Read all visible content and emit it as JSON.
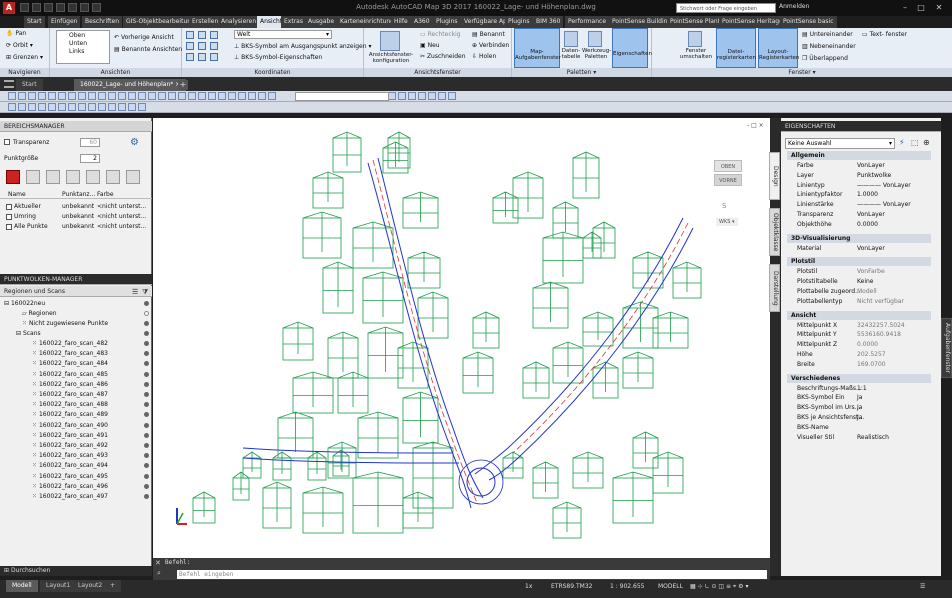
{
  "title_bar": {
    "title": "Autodesk AutoCAD Map 3D 2017   160022_Lage- und Höhenplan.dwg",
    "search_placeholder": "Stichwort oder Frage eingeben",
    "user": "Anmelden"
  },
  "ribbon_tabs": [
    "Start",
    "Einfügen",
    "Beschriften",
    "GIS-Objektbearbeitung",
    "Erstellen",
    "Analysieren",
    "Ansicht",
    "Extras",
    "Ausgabe",
    "Karteneinrichtung",
    "Hilfe",
    "A360",
    "Plugins",
    "Verfügbare Apps",
    "Plugins",
    "BIM 360",
    "Performance",
    "PointSense Building",
    "PointSense Plant",
    "PointSense Heritage",
    "PointSense basic"
  ],
  "ribbon_active": "Ansicht",
  "ribbon": {
    "navigieren": {
      "title": "Navigieren",
      "items": [
        "Pan",
        "Orbit",
        "Grenzen"
      ]
    },
    "ansichten": {
      "title": "Ansichten",
      "items": [
        "Oben",
        "Unten",
        "Links"
      ],
      "prev": "Vorherige Ansicht",
      "named": "Benannte Ansichten"
    },
    "koordinaten": {
      "title": "Koordinaten",
      "welt": "Welt",
      "ucs_show": "BKS-Symbol am Ausgangspunkt anzeigen",
      "ucs_props": "BKS-Symbol-Eigenschaften"
    },
    "ansichtsfenster": {
      "title": "Ansichtsfenster",
      "config": "Ansichtsfenster-konfiguration",
      "items": [
        "Rechteckig",
        "Neu",
        "Zuschneiden",
        "Benannt",
        "Verbinden",
        "Holen"
      ]
    },
    "paletten": {
      "title": "Paletten",
      "items": [
        "Map-Aufgabenfenster",
        "Daten-tabelle",
        "Werkzeug-Paletten",
        "Eigenschaften"
      ]
    },
    "fenster": {
      "title": "Fenster",
      "items": [
        "Fenster umschalten",
        "Datei-registerkarten",
        "Layout-Registerkarten"
      ],
      "arrange": [
        "Untereinander",
        "Nebeneinander",
        "Überlappend"
      ],
      "textfenster": "Text- fenster"
    }
  },
  "file_tabs": [
    "Start",
    "160022_Lage- und Höhenplan*"
  ],
  "bereichsmanager": {
    "title": "BEREICHSMANAGER",
    "transparenz": "Transparenz",
    "transparenz_val": "60",
    "punktgroesse": "Punktgröße",
    "punktgroesse_val": "2",
    "cols": [
      "Name",
      "Punktanz...",
      "Farbe"
    ],
    "rows": [
      [
        "Aktueller",
        "unbekannt",
        "<nicht unterst..."
      ],
      [
        "Umring",
        "unbekannt",
        "<nicht unterst..."
      ],
      [
        "Alle Punkte",
        "unbekannt",
        "<nicht unterst..."
      ]
    ]
  },
  "punktwolken": {
    "title": "PUNKTWOLKEN-MANAGER",
    "sub": "Regionen und Scans",
    "root": "160022neu",
    "regionen": "Regionen",
    "nicht": "Nicht zugewiesene Punkte",
    "scans_label": "Scans",
    "scans": [
      "160022_faro_scan_482",
      "160022_faro_scan_483",
      "160022_faro_scan_484",
      "160022_faro_scan_485",
      "160022_faro_scan_486",
      "160022_faro_scan_487",
      "160022_faro_scan_488",
      "160022_faro_scan_489",
      "160022_faro_scan_490",
      "160022_faro_scan_491",
      "160022_faro_scan_492",
      "160022_faro_scan_493",
      "160022_faro_scan_494",
      "160022_faro_scan_495",
      "160022_faro_scan_496",
      "160022_faro_scan_497"
    ],
    "footer": "Durchsuchen"
  },
  "viewcube": {
    "top": "OBEN",
    "front": "VORNE",
    "south": "S",
    "wcs": "WKS"
  },
  "command": {
    "label": "Befehl:",
    "placeholder": "Befehl eingeben"
  },
  "eigenschaften": {
    "title": "EIGENSCHAFTEN",
    "selection": "Keine Auswahl",
    "vtabs": [
      "Design",
      "Objektklasse",
      "Darstellung"
    ],
    "side_label": "Aufgabenfenster",
    "sections": [
      {
        "name": "Allgemein",
        "props": [
          [
            "Farbe",
            "VonLayer"
          ],
          [
            "Layer",
            "Punktwolke"
          ],
          [
            "Linientyp",
            "———— VonLayer"
          ],
          [
            "Linientypfaktor",
            "1.0000"
          ],
          [
            "Linienstärke",
            "———— VonLayer"
          ],
          [
            "Transparenz",
            "VonLayer"
          ],
          [
            "Objekthöhe",
            "0.0000"
          ]
        ]
      },
      {
        "name": "3D-Visualisierung",
        "props": [
          [
            "Material",
            "VonLayer"
          ]
        ]
      },
      {
        "name": "Plotstil",
        "props": [
          [
            "Plotstil",
            "VonFarbe"
          ],
          [
            "Plotstiltabelle",
            "Keine"
          ],
          [
            "Plottabelle zugeord...",
            "Modell"
          ],
          [
            "Plottabellentyp",
            "Nicht verfügbar"
          ]
        ]
      },
      {
        "name": "Ansicht",
        "props": [
          [
            "Mittelpunkt X",
            "32432257.5024"
          ],
          [
            "Mittelpunkt Y",
            "5536160.9418"
          ],
          [
            "Mittelpunkt Z",
            "0.0000"
          ],
          [
            "Höhe",
            "202.5257"
          ],
          [
            "Breite",
            "169.0700"
          ]
        ]
      },
      {
        "name": "Verschiedenes",
        "props": [
          [
            "Beschriftungs-Maßs...",
            "1:1"
          ],
          [
            "BKS-Symbol Ein",
            "Ja"
          ],
          [
            "BKS-Symbol im Urs...",
            "Ja"
          ],
          [
            "BKS je Ansichtsfenst...",
            "Ja"
          ],
          [
            "BKS-Name",
            ""
          ],
          [
            "Visueller Stil",
            "Realistisch"
          ]
        ]
      }
    ]
  },
  "status": {
    "tabs": [
      "Modell",
      "Layout1",
      "Layout2"
    ],
    "coords": "ETRS89.TM32",
    "scale": "1 : 902.655",
    "modell": "MODELL",
    "zoom": "1x",
    "plus": "+"
  }
}
